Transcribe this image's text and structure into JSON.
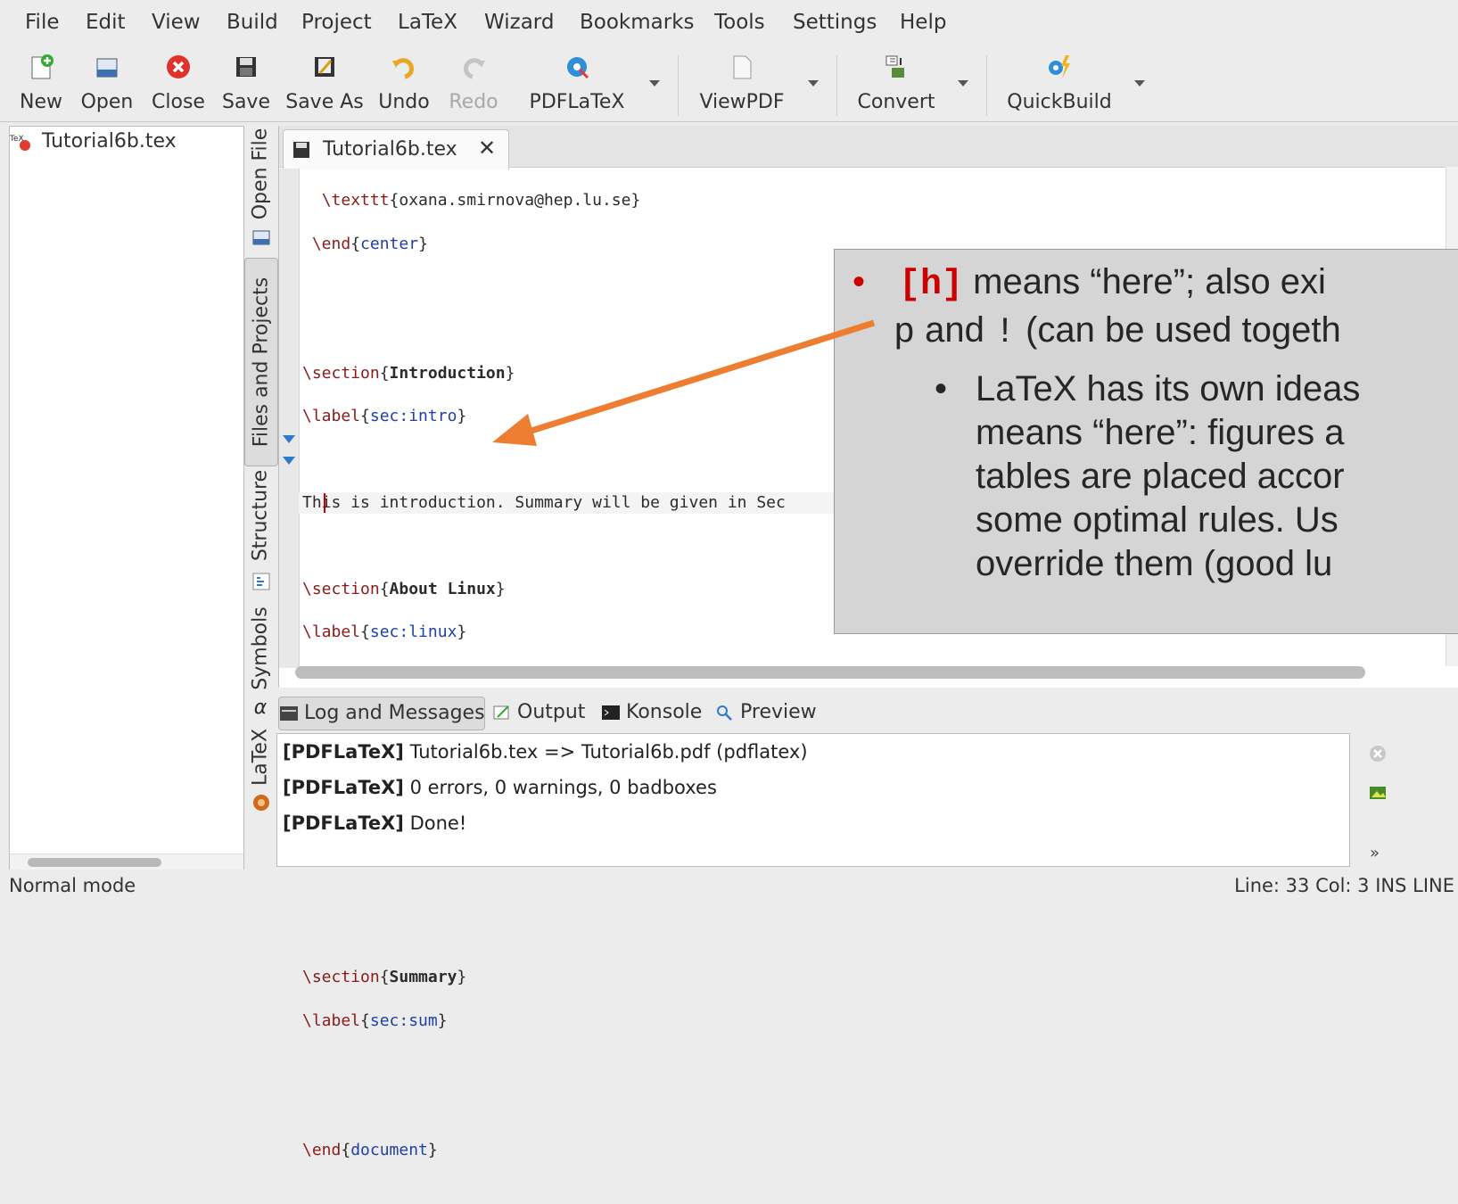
{
  "menu": [
    "File",
    "Edit",
    "View",
    "Build",
    "Project",
    "LaTeX",
    "Wizard",
    "Bookmarks",
    "Tools",
    "Settings",
    "Help"
  ],
  "toolbar": {
    "new": "New",
    "open": "Open",
    "close": "Close",
    "save": "Save",
    "save_as": "Save As",
    "undo": "Undo",
    "redo": "Redo",
    "pdflatex": "PDFLaTeX",
    "viewpdf": "ViewPDF",
    "convert": "Convert",
    "quickbuild": "QuickBuild"
  },
  "files_panel": {
    "file": "Tutorial6b.tex"
  },
  "side_tabs": {
    "open_file": "Open File",
    "files_projects": "Files and Projects",
    "structure": "Structure",
    "symbols": "Symbols",
    "latex": "LaTeX"
  },
  "editor": {
    "tab_title": "Tutorial6b.tex",
    "close_glyph": "✕"
  },
  "overlay": {
    "bullet1_code": "[h]",
    "bullet1_text": " means “here”; also exi",
    "bullet1_line2_p": "p",
    "bullet1_line2_and": " and ",
    "bullet1_line2_bang": "!",
    "bullet1_line2_rest": " (can be used togeth",
    "sub_lines": [
      "LaTeX has its own ideas",
      "means “here”: figures a",
      "tables are placed accor",
      "some optimal rules. Us",
      "override them (good lu"
    ]
  },
  "bottom_tabs": {
    "log": "Log and Messages",
    "output": "Output",
    "konsole": "Konsole",
    "preview": "Preview"
  },
  "log": [
    {
      "tag": "[PDFLaTeX]",
      "text": " Tutorial6b.tex => Tutorial6b.pdf (pdflatex)"
    },
    {
      "tag": "[PDFLaTeX]",
      "text": " 0 errors, 0 warnings, 0 badboxes"
    },
    {
      "tag": "[PDFLaTeX]",
      "text": " Done!"
    }
  ],
  "status": {
    "mode": "Normal mode",
    "position": "Line: 33 Col: 3  INS  LINE"
  },
  "colors": {
    "accent_red": "#cc0000",
    "arrow_orange": "#ed7d31",
    "keyword": "#8b1a1a",
    "argument": "#1f3fa8"
  }
}
